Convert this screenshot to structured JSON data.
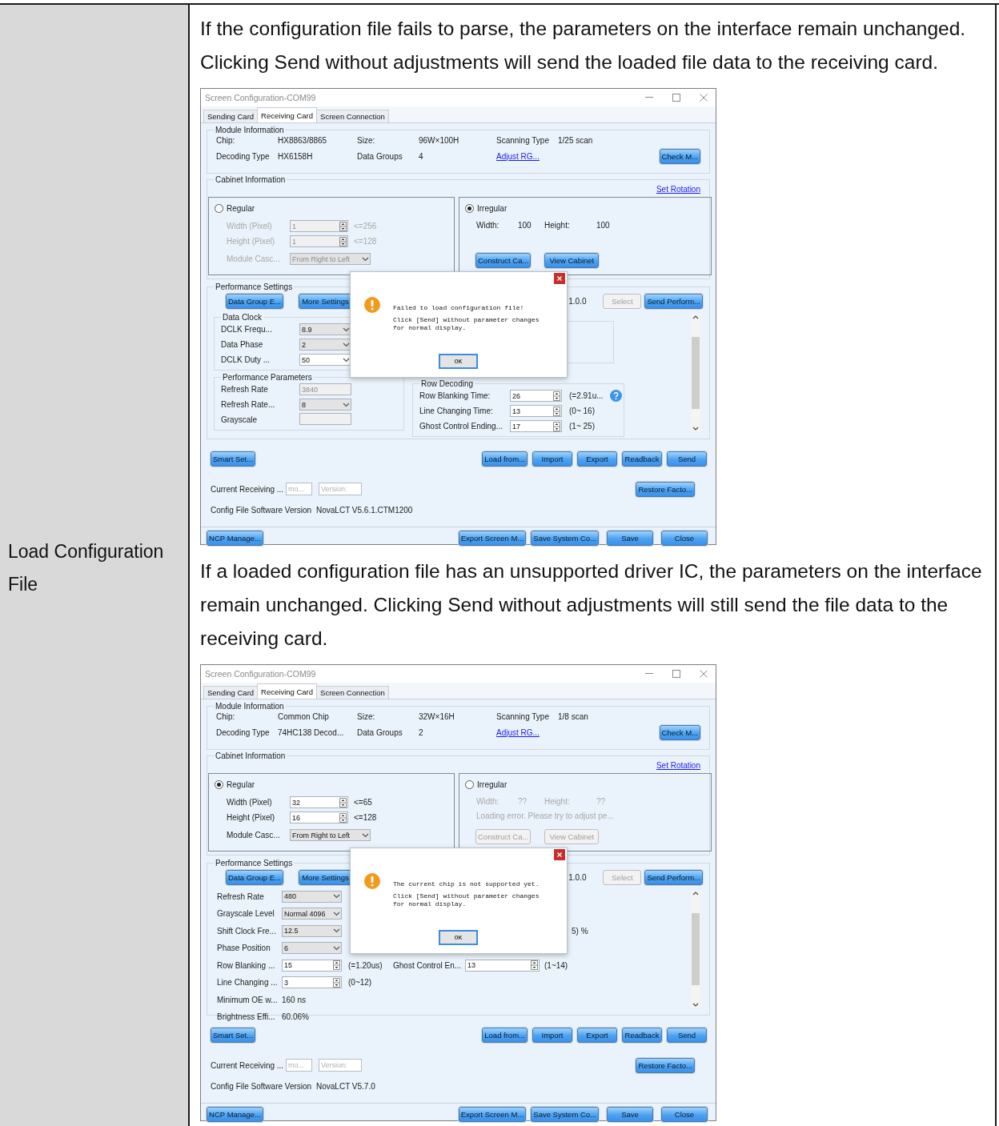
{
  "row_label": "Load Configuration File",
  "blocks": [
    {
      "kind": "paragraph",
      "text": "If the configuration file fails to parse, the parameters on the interface remain unchanged. Clicking Send without adjustments will send the loaded file data to the receiving card."
    },
    {
      "kind": "window",
      "title": "Screen Configuration-COM99",
      "tabs": [
        {
          "label": "Sending Card",
          "selected": false
        },
        {
          "label": "Receiving Card",
          "selected": true
        },
        {
          "label": "Screen Connection",
          "selected": false
        }
      ],
      "module_info": {
        "title": "Module Information",
        "fields": [
          {
            "label": "Chip:",
            "value": "HX8863/8865"
          },
          {
            "label": "Size:",
            "value": "96W×100H"
          },
          {
            "label": "Scanning Type",
            "value": "1/25 scan"
          },
          {
            "label": "Decoding Type",
            "value": "HX6158H"
          },
          {
            "label": "Data Groups",
            "value": "4"
          }
        ],
        "link": "Adjust RG...",
        "button": "Check M..."
      },
      "cabinet": {
        "title": "Cabinet Information",
        "link": "Set Rotation",
        "regular": {
          "label": "Regular",
          "selected": false,
          "disabled": true,
          "width": {
            "label": "Width (Pixel)",
            "value": "1",
            "limit": "<=256"
          },
          "height": {
            "label": "Height (Pixel)",
            "value": "1",
            "limit": "<=128"
          },
          "cascade": {
            "label": "Module Casc...",
            "value": "From Right to Left"
          }
        },
        "irregular": {
          "label": "Irregular",
          "selected": true,
          "disabled": false,
          "width_label": "Width:",
          "width_value": "100",
          "height_label": "Height:",
          "height_value": "100",
          "buttons": [
            "Construct Ca...",
            "View Cabinet"
          ]
        }
      },
      "performance": {
        "title": "Performance Settings",
        "buttons": [
          "Data Group E...",
          "More Settings"
        ],
        "version": "1.0.0",
        "select": {
          "label": "Select",
          "disabled": true
        },
        "send_button": "Send Perform...",
        "columns": [
          [
            {
              "kind": "group",
              "title": "Data Clock",
              "rows": [
                {
                  "label": "DCLK Frequ...",
                  "control": {
                    "kind": "dropdown",
                    "value": "8.9"
                  }
                },
                {
                  "label": "Data Phase",
                  "control": {
                    "kind": "dropdown",
                    "value": "2"
                  }
                },
                {
                  "label": "DCLK Duty ...",
                  "control": {
                    "kind": "combo",
                    "value": "50"
                  }
                }
              ]
            },
            {
              "kind": "group",
              "title": "Performance Parameters",
              "rows": [
                {
                  "label": "Refresh Rate",
                  "control": {
                    "kind": "field",
                    "value": "3840",
                    "disabled": true
                  }
                },
                {
                  "label": "Refresh Rate...",
                  "control": {
                    "kind": "dropdown",
                    "value": "8"
                  }
                },
                {
                  "label": "Grayscale",
                  "control": {
                    "kind": "field",
                    "disabled": true
                  }
                }
              ]
            }
          ],
          [
            {
              "kind": "blank"
            },
            {
              "kind": "group",
              "title": "Row Decoding",
              "rows": [
                {
                  "label": "Row Blanking Time:",
                  "control": {
                    "kind": "spin",
                    "value": "26"
                  },
                  "note": "(=2.91u...",
                  "help": true
                },
                {
                  "label": "Line Changing Time:",
                  "control": {
                    "kind": "spin",
                    "value": "13"
                  },
                  "note": "(0~ 16)"
                },
                {
                  "label": "Ghost Control Ending...",
                  "control": {
                    "kind": "spin",
                    "value": "17"
                  },
                  "note": "(1~ 25)"
                }
              ]
            }
          ]
        ]
      },
      "left_buttons": [
        "Smart Set..."
      ],
      "right_buttons": [
        "Load from...",
        "Import",
        "Export",
        "Readback",
        "Send"
      ],
      "receiving": {
        "label": "Current Receiving ...",
        "fields": [
          {
            "placeholder": "mo..."
          },
          {
            "placeholder": "Version:"
          }
        ],
        "button": "Restore Facto..."
      },
      "config_version": {
        "label": "Config File Software Version",
        "value": "NovaLCT V5.6.1.CTM1200"
      },
      "footer": {
        "left": "NCP Manage...",
        "right": [
          "Export Screen M...",
          "Save System Co...",
          "Save",
          "Close"
        ]
      },
      "dialog": {
        "message": "Failed to load configuration file!",
        "hint": "Click [Send] without parameter changes for normal display.",
        "ok": "OK"
      }
    },
    {
      "kind": "paragraph",
      "text": "If a loaded configuration file has an unsupported driver IC, the parameters on the interface remain unchanged. Clicking Send without adjustments will still send the file data to the receiving card."
    },
    {
      "kind": "window",
      "title": "Screen Configuration-COM99",
      "tabs": [
        {
          "label": "Sending Card",
          "selected": false
        },
        {
          "label": "Receiving Card",
          "selected": true
        },
        {
          "label": "Screen Connection",
          "selected": false
        }
      ],
      "module_info": {
        "title": "Module Information",
        "fields": [
          {
            "label": "Chip:",
            "value": "Common Chip"
          },
          {
            "label": "Size:",
            "value": "32W×16H"
          },
          {
            "label": "Scanning Type",
            "value": "1/8 scan"
          },
          {
            "label": "Decoding Type",
            "value": "74HC138 Decod..."
          },
          {
            "label": "Data Groups",
            "value": "2"
          }
        ],
        "link": "Adjust RG...",
        "button": "Check M..."
      },
      "cabinet": {
        "title": "Cabinet Information",
        "link": "Set Rotation",
        "regular": {
          "label": "Regular",
          "selected": true,
          "disabled": false,
          "width": {
            "label": "Width (Pixel)",
            "value": "32",
            "limit": "<=65"
          },
          "height": {
            "label": "Height (Pixel)",
            "value": "16",
            "limit": "<=128"
          },
          "cascade": {
            "label": "Module Casc...",
            "value": "From Right to Left"
          }
        },
        "irregular": {
          "label": "Irregular",
          "selected": false,
          "disabled": true,
          "width_label": "Width:",
          "width_value": "??",
          "height_label": "Height:",
          "height_value": "??",
          "message": "Loading error. Please try to adjust pe...",
          "buttons": [
            "Construct Ca...",
            "View Cabinet"
          ]
        }
      },
      "performance": {
        "title": "Performance Settings",
        "buttons": [
          "Data Group E...",
          "More Settings"
        ],
        "version": "1.0.0",
        "select": {
          "label": "Select",
          "disabled": true
        },
        "send_button": "Send Perform...",
        "columns": [
          [
            {
              "kind": "row",
              "label": "Refresh Rate",
              "control": {
                "kind": "dropdown",
                "value": "480"
              }
            },
            {
              "kind": "row",
              "label": "Grayscale Level",
              "control": {
                "kind": "dropdown",
                "value": "Normal 4096"
              }
            },
            {
              "kind": "row",
              "label": "Shift Clock Fre...",
              "control": {
                "kind": "dropdown",
                "value": "12.5"
              },
              "tail": "5) %"
            },
            {
              "kind": "row",
              "label": "Phase Position",
              "control": {
                "kind": "dropdown",
                "value": "6"
              }
            },
            {
              "kind": "row",
              "label": "Row Blanking ...",
              "control": {
                "kind": "spin",
                "value": "15"
              },
              "note": "(=1.20us)",
              "side": {
                "label": "Ghost Control En...",
                "control": {
                  "kind": "spin",
                  "value": "13"
                },
                "note": "(1~14)"
              }
            },
            {
              "kind": "row",
              "label": "Line Changing ...",
              "control": {
                "kind": "spin",
                "value": "3"
              },
              "note": "(0~12)"
            },
            {
              "kind": "row",
              "label": "Minimum OE w...",
              "control": {
                "kind": "text",
                "value": "160 ns"
              }
            },
            {
              "kind": "row",
              "label": "Brightness Effi...",
              "control": {
                "kind": "text",
                "value": "60.06%"
              }
            }
          ]
        ]
      },
      "left_buttons": [
        "Smart Set..."
      ],
      "right_buttons": [
        "Load from...",
        "Import",
        "Export",
        "Readback",
        "Send"
      ],
      "receiving": {
        "label": "Current Receiving ...",
        "fields": [
          {
            "placeholder": "mo..."
          },
          {
            "placeholder": "Version:"
          }
        ],
        "button": "Restore Facto..."
      },
      "config_version": {
        "label": "Config File Software Version",
        "value": "NovaLCT V5.7.0"
      },
      "footer": {
        "left": "NCP Manage...",
        "right": [
          "Export Screen M...",
          "Save System Co...",
          "Save",
          "Close"
        ]
      },
      "dialog": {
        "message": "The current chip is not supported yet.",
        "hint": "Click [Send] without parameter changes for normal display.",
        "ok": "OK"
      }
    }
  ]
}
